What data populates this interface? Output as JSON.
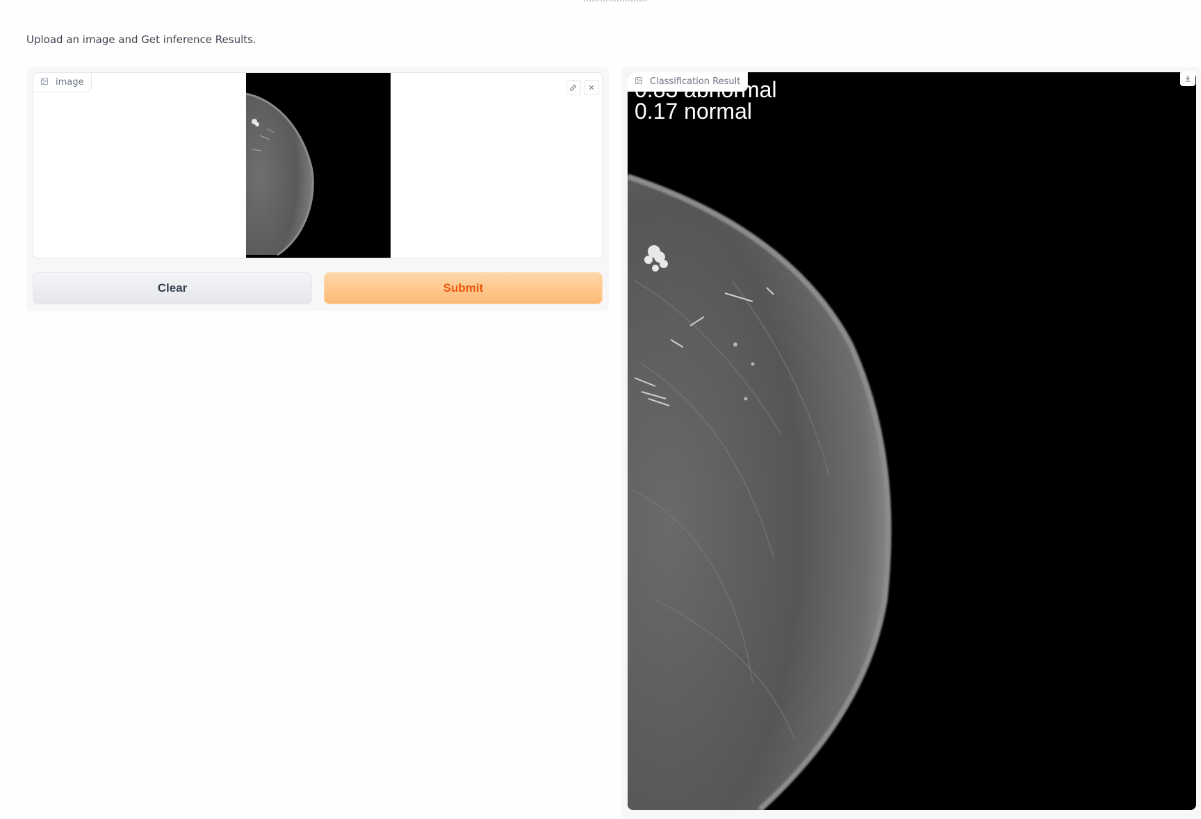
{
  "description": "Upload an image and Get inference Results.",
  "input": {
    "label": "image",
    "label_icon": "image-icon",
    "edit_icon": "pencil-icon",
    "clear_icon": "close-icon"
  },
  "buttons": {
    "clear_label": "Clear",
    "submit_label": "Submit"
  },
  "output": {
    "label": "Classification Result",
    "label_icon": "image-icon",
    "download_icon": "download-icon",
    "results": [
      "0.83 abnormal",
      "0.17 normal"
    ]
  },
  "colors": {
    "submit_bg": "#fdba74",
    "submit_text": "#ea580c",
    "clear_bg": "#e5e7eb"
  }
}
